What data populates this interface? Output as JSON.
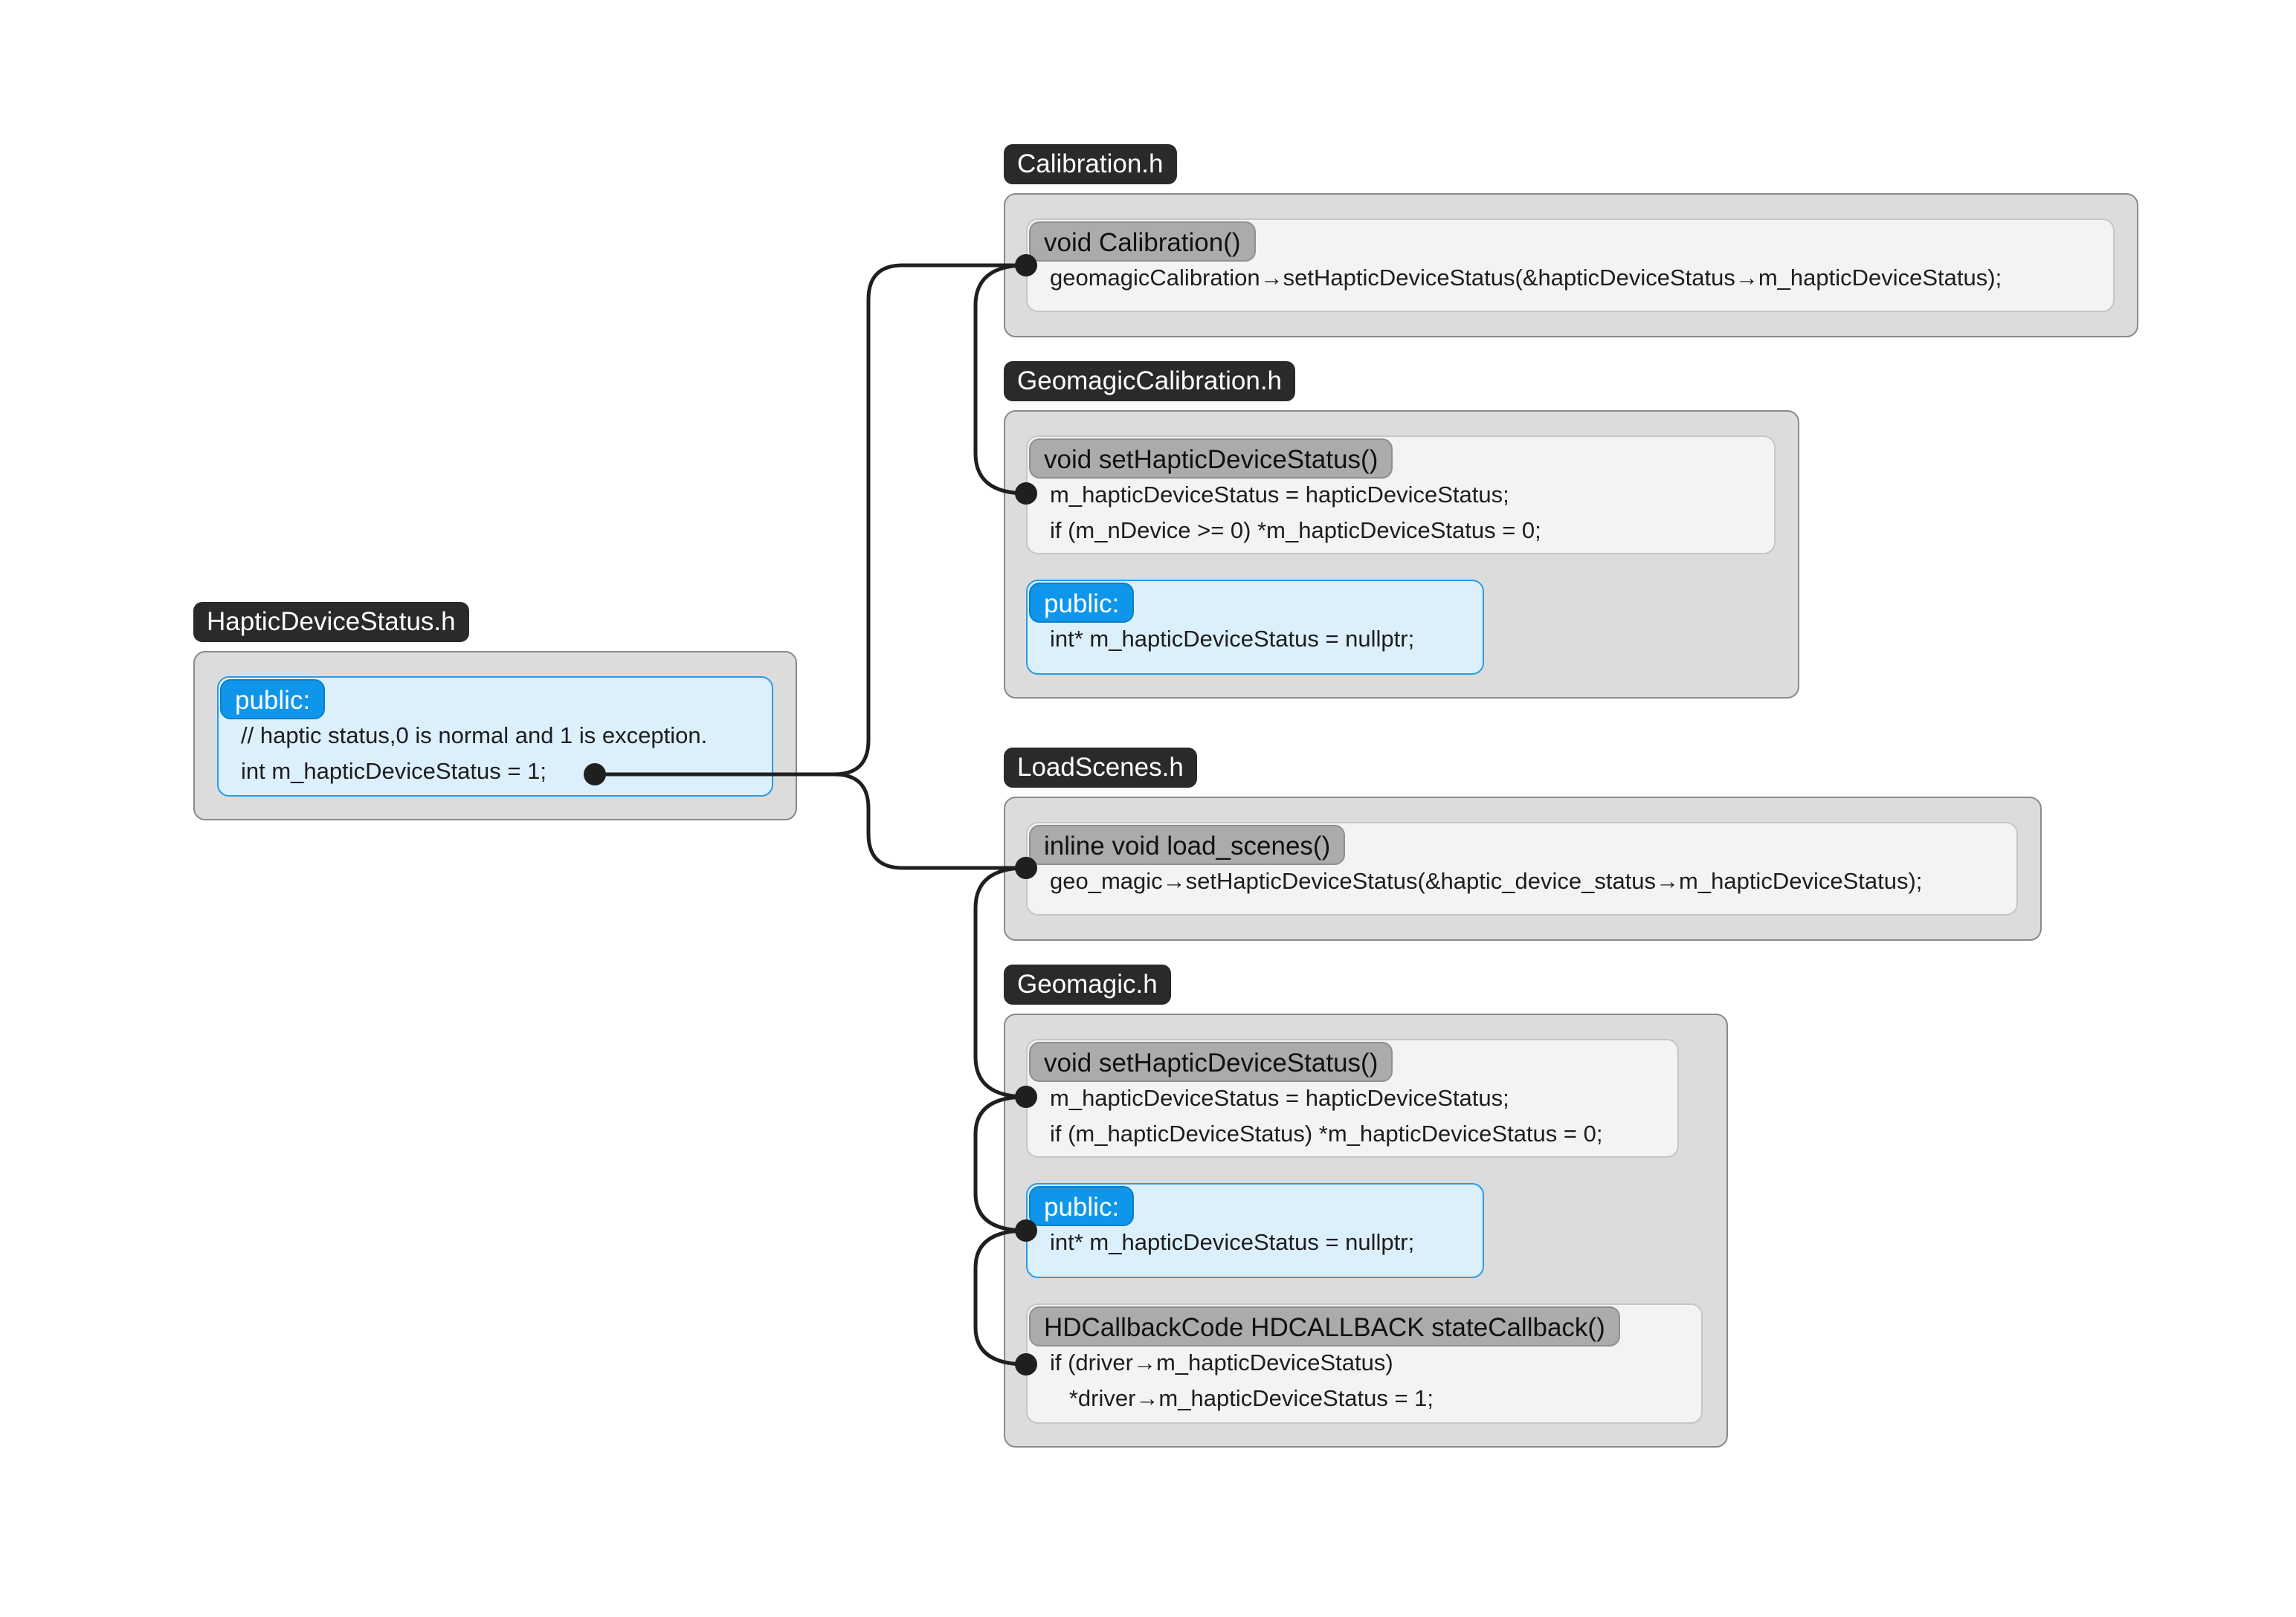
{
  "files": [
    {
      "name": "Calibration.h",
      "blocks": [
        {
          "kind": "function",
          "label": "void Calibration()",
          "lines": [
            "geomagicCalibration→setHapticDeviceStatus(&hapticDeviceStatus→m_hapticDeviceStatus);"
          ]
        }
      ]
    },
    {
      "name": "GeomagicCalibration.h",
      "blocks": [
        {
          "kind": "function",
          "label": "void setHapticDeviceStatus()",
          "lines": [
            "m_hapticDeviceStatus = hapticDeviceStatus;",
            "if (m_nDevice >= 0) *m_hapticDeviceStatus = 0;"
          ]
        },
        {
          "kind": "public",
          "label": "public:",
          "lines": [
            "int* m_hapticDeviceStatus = nullptr;"
          ]
        }
      ]
    },
    {
      "name": "HapticDeviceStatus.h",
      "blocks": [
        {
          "kind": "public",
          "label": "public:",
          "lines": [
            "// haptic status,0 is normal and 1 is exception.",
            "int m_hapticDeviceStatus = 1;"
          ]
        }
      ]
    },
    {
      "name": "LoadScenes.h",
      "blocks": [
        {
          "kind": "function",
          "label": "inline void load_scenes()",
          "lines": [
            "geo_magic→setHapticDeviceStatus(&haptic_device_status→m_hapticDeviceStatus);"
          ]
        }
      ]
    },
    {
      "name": "Geomagic.h",
      "blocks": [
        {
          "kind": "function",
          "label": "void setHapticDeviceStatus()",
          "lines": [
            "m_hapticDeviceStatus = hapticDeviceStatus;",
            "if (m_hapticDeviceStatus) *m_hapticDeviceStatus = 0;"
          ]
        },
        {
          "kind": "public",
          "label": "public:",
          "lines": [
            "int* m_hapticDeviceStatus = nullptr;"
          ]
        },
        {
          "kind": "function",
          "label": "HDCallbackCode HDCALLBACK stateCallback()",
          "lines": [
            "if (driver→m_hapticDeviceStatus)",
            "   *driver→m_hapticDeviceStatus = 1;"
          ]
        }
      ]
    }
  ],
  "colors": {
    "file_label_bg": "#2a2a2a",
    "file_box_bg": "#dcdcdc",
    "function_bg": "#f3f3f3",
    "function_label_bg": "#ababab",
    "public_bg": "#dcf0fc",
    "public_label_bg": "#0f96eb",
    "connector": "#1f1f1f"
  },
  "icons": [
    "connector-dot-icon"
  ]
}
